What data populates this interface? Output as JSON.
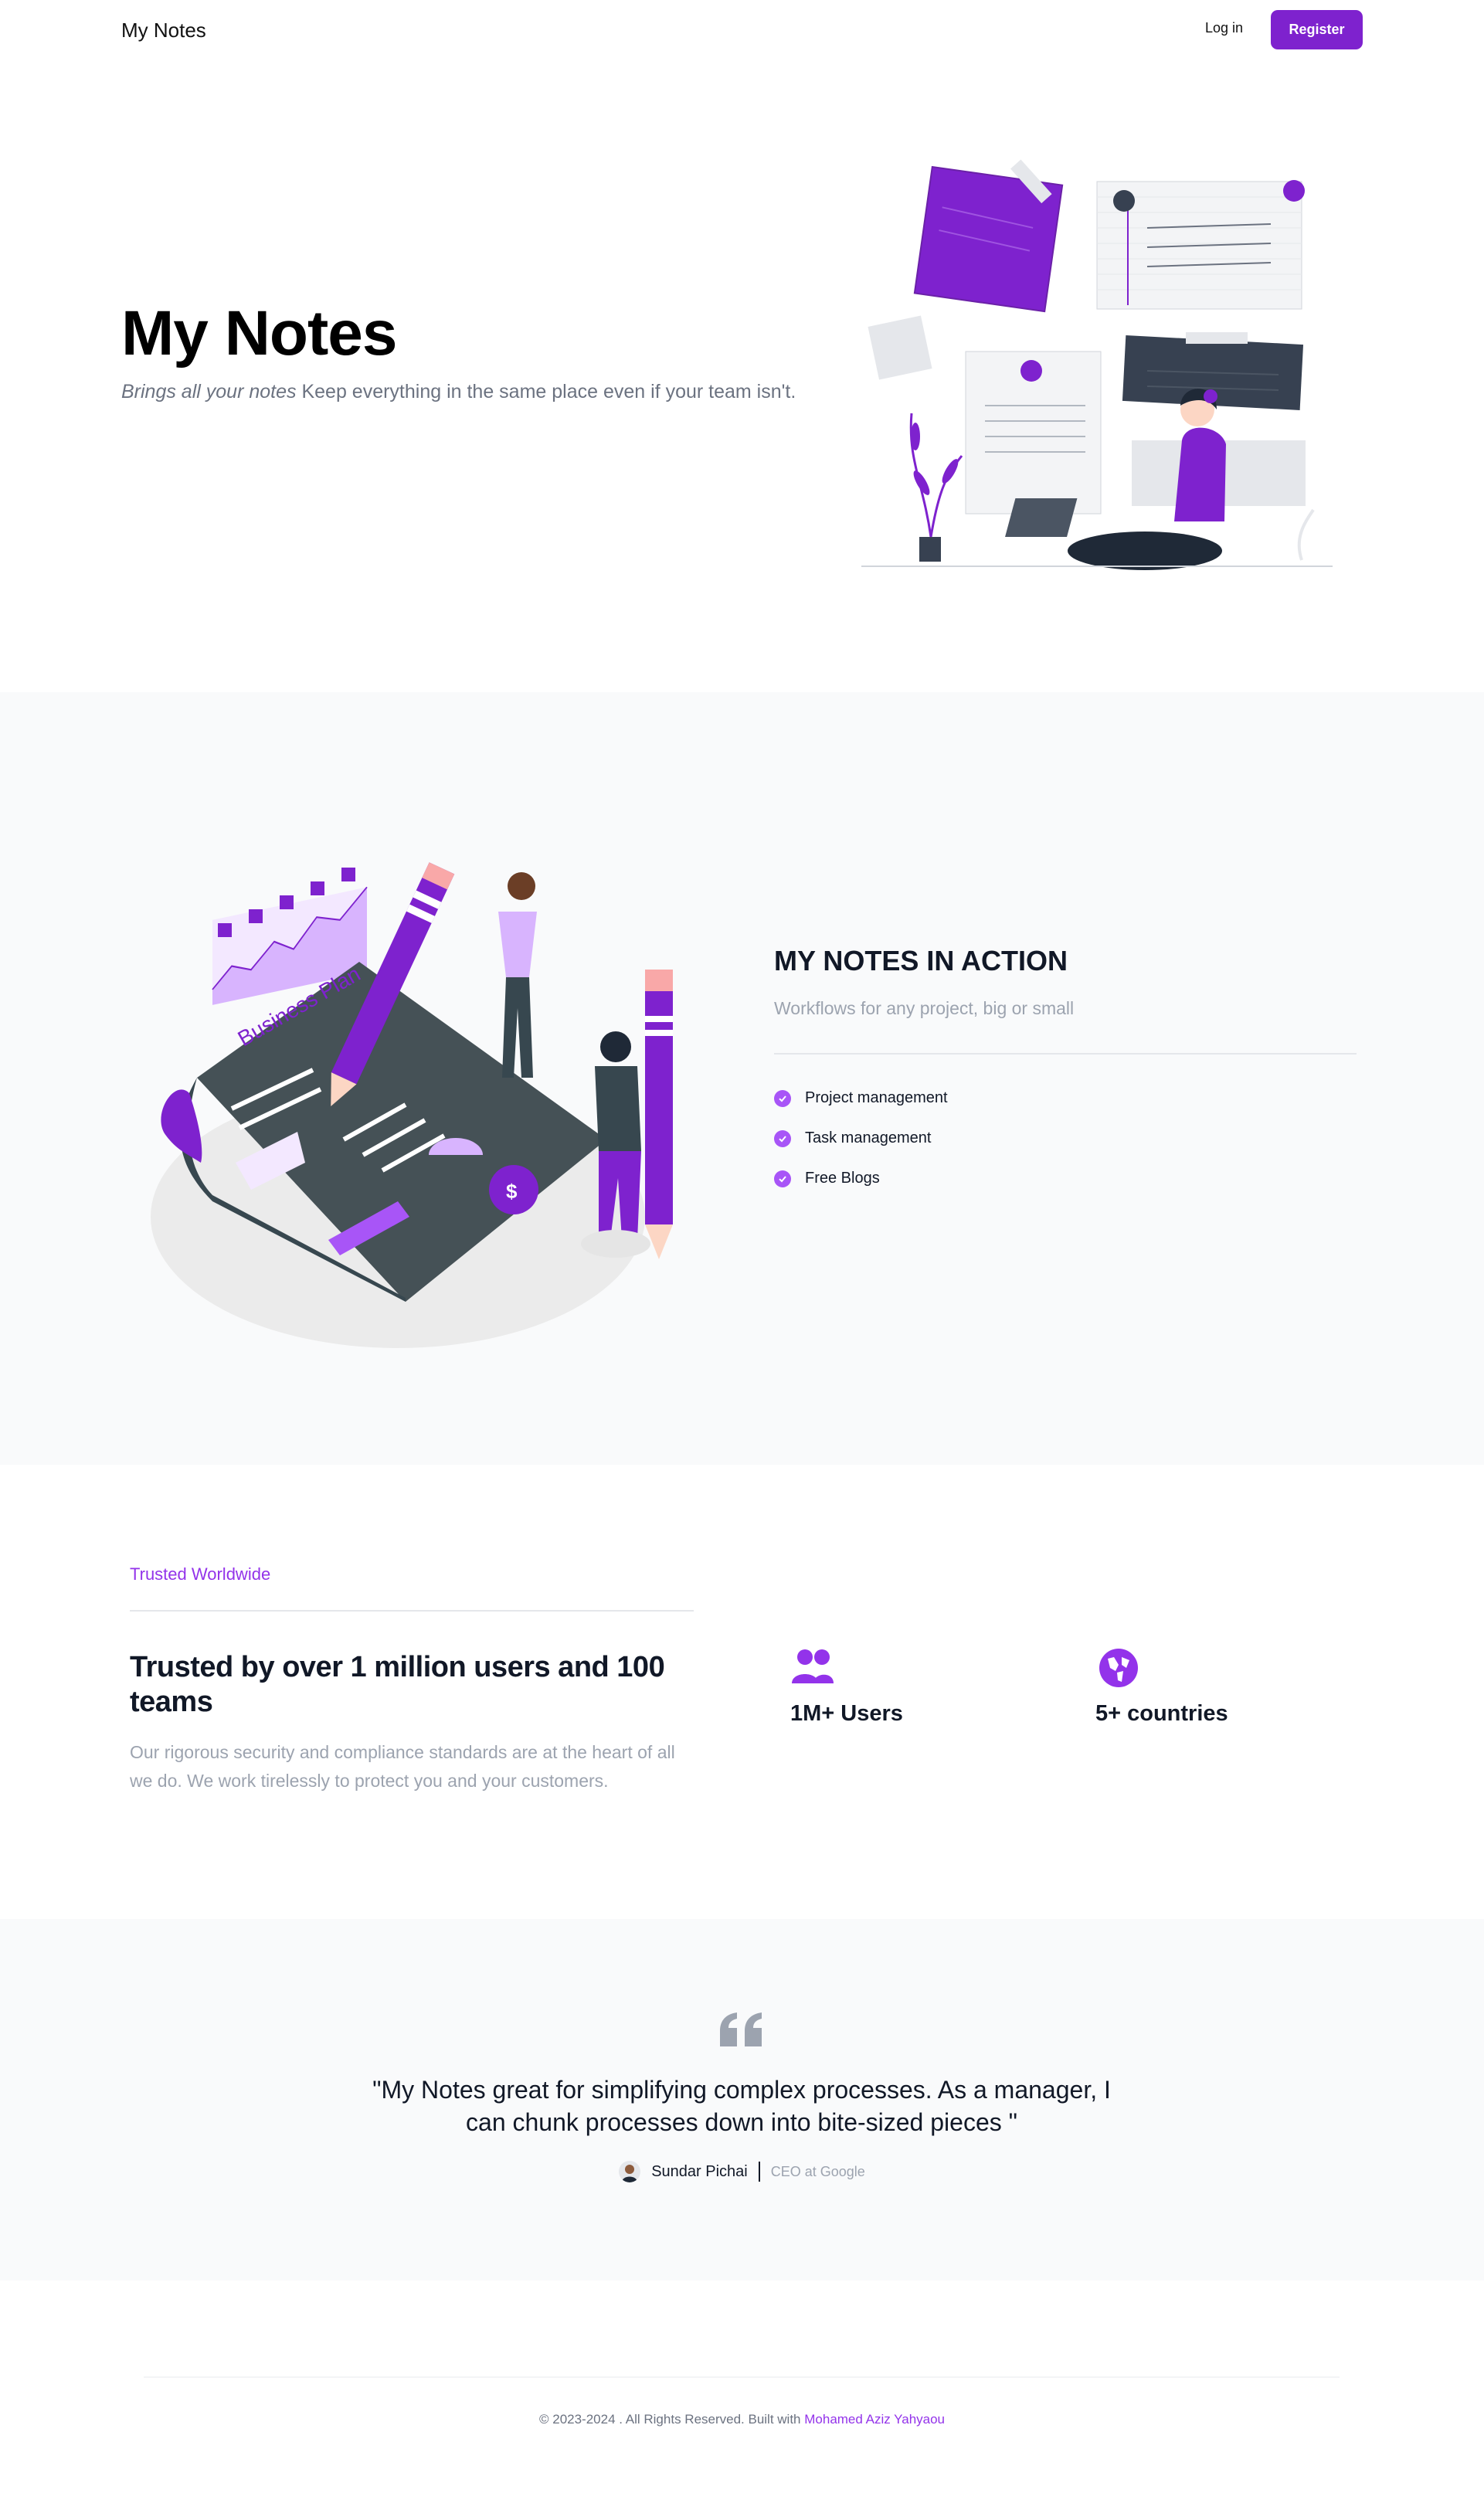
{
  "nav": {
    "brand": "My Notes",
    "login": "Log in",
    "register": "Register"
  },
  "hero": {
    "title": "My Notes",
    "subtitle_em": "Brings all your notes",
    "subtitle_rest": " Keep everything in the same place even if your team isn't."
  },
  "action": {
    "title": "MY NOTES IN ACTION",
    "subtitle": "Workflows for any project, big or small",
    "features": [
      "Project management",
      "Task management",
      "Free Blogs"
    ],
    "illustration_text": "Business Plan"
  },
  "trusted": {
    "label": "Trusted Worldwide",
    "title": "Trusted by over 1 million users and 100 teams",
    "description": "Our rigorous security and compliance standards are at the heart of all we do. We work tirelessly to protect you and your customers.",
    "stats": [
      {
        "label": "1M+ Users",
        "icon": "users-icon"
      },
      {
        "label": "5+ countries",
        "icon": "globe-icon"
      }
    ]
  },
  "testimonial": {
    "quote": "\"My Notes great for simplifying complex processes. As a manager, I can chunk processes down into bite-sized pieces \"",
    "name": "Sundar Pichai",
    "role": "CEO at Google"
  },
  "footer": {
    "text": "© 2023-2024 . All Rights Reserved. Built with ",
    "link": "Mohamed Aziz Yahyaou"
  },
  "colors": {
    "accent": "#7e22ce",
    "accent_light": "#a855f7",
    "gray_bg": "#f9fafb"
  }
}
